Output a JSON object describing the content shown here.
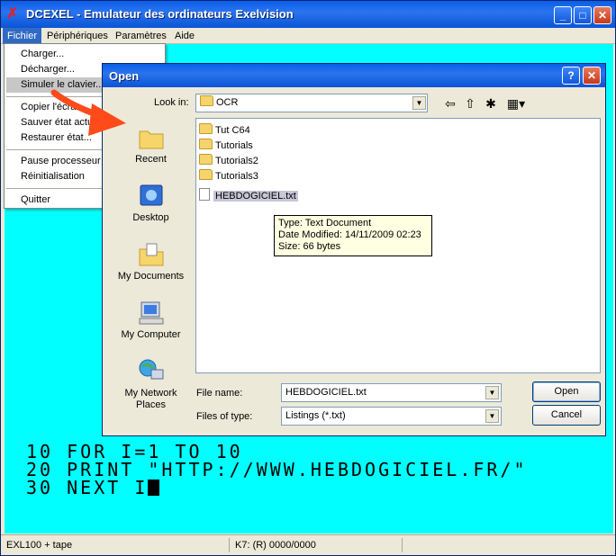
{
  "window": {
    "title": "DCEXEL - Emulateur des ordinateurs Exelvision",
    "buttons": {
      "minimize": "_",
      "maximize": "□",
      "close": "✕"
    }
  },
  "menubar": [
    "Fichier",
    "Périphériques",
    "Paramètres",
    "Aide"
  ],
  "file_menu": {
    "group1": [
      "Charger...",
      "Décharger...",
      "Simuler le clavier..."
    ],
    "group2": [
      "Copier l'écran...",
      "Sauver état actuel",
      "Restaurer état..."
    ],
    "group3": [
      "Pause processeur",
      "Réinitialisation"
    ],
    "group4": [
      "Quitter"
    ]
  },
  "screen_lines": [
    "10 FOR I=1 TO 10",
    "20 PRINT \"HTTP://WWW.HEBDOGICIEL.FR/\"",
    "30 NEXT I"
  ],
  "status": {
    "left": "EXL100 + tape",
    "middle": "K7: (R)  0000/0000"
  },
  "dialog": {
    "title": "Open",
    "help": "?",
    "close": "✕",
    "look_in_label": "Look in:",
    "look_in_value": "OCR",
    "places": [
      "Recent",
      "Desktop",
      "My Documents",
      "My Computer",
      "My Network Places"
    ],
    "folders": [
      "Tut C64",
      "Tutorials",
      "Tutorials2",
      "Tutorials3"
    ],
    "file": "HEBDOGICIEL.txt",
    "tooltip": {
      "type": "Type: Text Document",
      "modified": "Date Modified: 14/11/2009 02:23",
      "size": "Size: 66 bytes"
    },
    "file_name_label": "File name:",
    "file_name_value": "HEBDOGICIEL.txt",
    "files_of_type_label": "Files of type:",
    "files_of_type_value": "Listings (*.txt)",
    "open_button": "Open",
    "cancel_button": "Cancel"
  },
  "colors": {
    "screen": "#00ffff",
    "titlebar": "#0a5ee8",
    "arrow": "#ff4a1a"
  }
}
